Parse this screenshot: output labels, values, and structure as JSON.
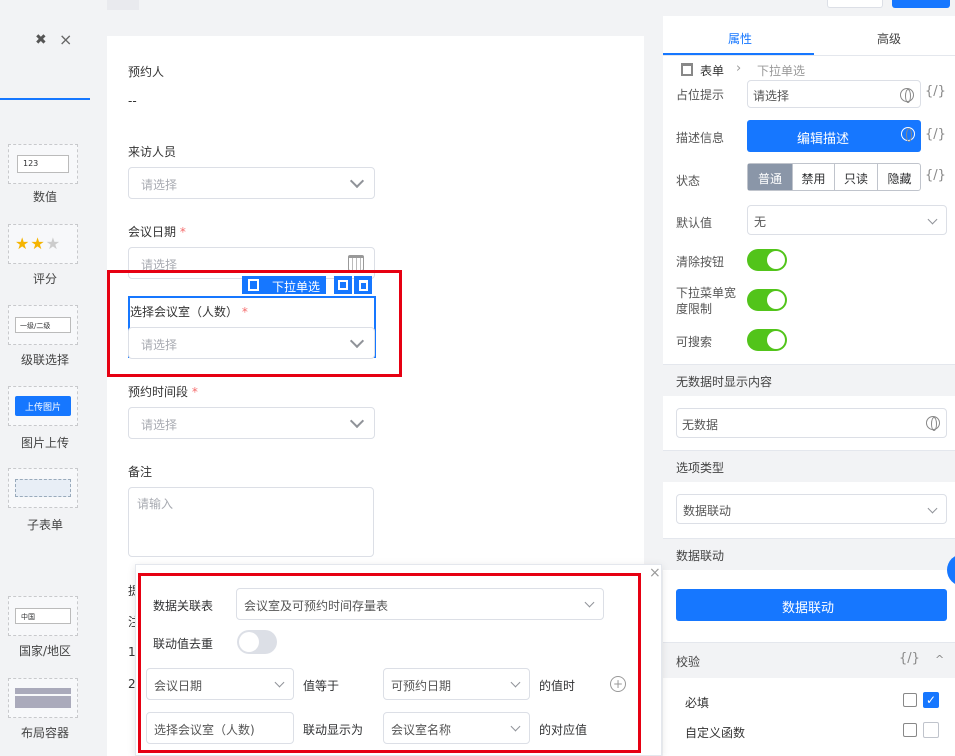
{
  "left_palette": {
    "items": [
      {
        "preview": "123",
        "label": "数值",
        "icon": "number-field-icon"
      },
      {
        "preview": "",
        "label": "评分",
        "icon": "star-rating-icon"
      },
      {
        "preview": "一级/二级",
        "label": "级联选择",
        "icon": "cascader-icon"
      },
      {
        "preview": "上传图片",
        "label": "图片上传",
        "icon": "upload-image-icon"
      },
      {
        "preview": "",
        "label": "子表单",
        "icon": "subform-icon"
      },
      {
        "preview": "中国",
        "label": "国家/地区",
        "icon": "country-select-icon"
      },
      {
        "preview": "",
        "label": "布局容器",
        "icon": "layout-container-icon"
      }
    ]
  },
  "form": {
    "booker_label": "预约人",
    "booker_value": "--",
    "visitor_label": "来访人员",
    "visitor_placeholder": "请选择",
    "date_label": "会议日期",
    "date_placeholder": "请选择",
    "room_label": "选择会议室（人数）",
    "room_placeholder": "请选择",
    "room_toolbar_label": "下拉单选",
    "slot_label": "预约时间段",
    "slot_placeholder": "请选择",
    "remark_label": "备注",
    "remark_placeholder": "请输入",
    "required_mark": "*",
    "partial_labels": [
      "提",
      "注",
      "1",
      "2"
    ]
  },
  "right_panel": {
    "tabs": [
      "属性",
      "高级"
    ],
    "breadcrumb": [
      "表单",
      "下拉单选"
    ],
    "placeholder_label": "占位提示",
    "placeholder_value": "请选择",
    "desc_label": "描述信息",
    "desc_button": "编辑描述",
    "state_label": "状态",
    "state_options": [
      "普通",
      "禁用",
      "只读",
      "隐藏"
    ],
    "state_selected": "普通",
    "default_label": "默认值",
    "default_value": "无",
    "clear_label": "清除按钮",
    "width_limit_label": "下拉菜单宽度限制",
    "searchable_label": "可搜索",
    "empty_section": "无数据时显示内容",
    "empty_value": "无数据",
    "option_type_section": "选项类型",
    "option_type_value": "数据联动",
    "linkage_section": "数据联动",
    "linkage_button": "数据联动",
    "validate_section": "校验",
    "required_label": "必填",
    "custom_fn_label": "自定义函数",
    "fx": "{/}",
    "accent": "#1677ff",
    "toggle_color": "#52c41a"
  },
  "popover": {
    "table_label": "数据关联表",
    "table_value": "会议室及可预约时间存量表",
    "dedupe_label": "联动值去重",
    "cond_field": "会议日期",
    "cond_op": "值等于",
    "cond_target": "可预约日期",
    "cond_suffix": "的值时",
    "show_field": "选择会议室（人数)",
    "show_op": "联动显示为",
    "show_target": "会议室名称",
    "show_suffix": "的对应值",
    "close": "×",
    "add": "+"
  },
  "highlight_color": "#e60012"
}
